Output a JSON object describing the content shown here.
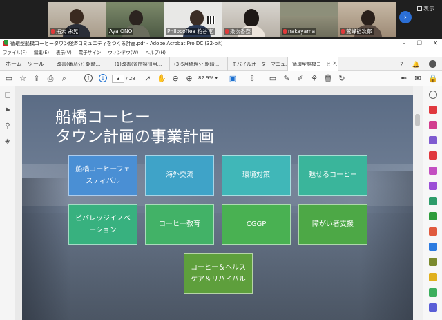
{
  "video_tiles": [
    {
      "name": "拓大 永晃",
      "muted": true
    },
    {
      "name": "Aya ONO",
      "muted": false
    },
    {
      "name": "Philocoffea 粕谷 哲",
      "muted": false
    },
    {
      "name": "染次香奈",
      "muted": true
    },
    {
      "name": "nakayama",
      "muted": true
    },
    {
      "name": "鷲峰裕次郎",
      "muted": true
    }
  ],
  "view_label": "表示",
  "window": {
    "title": "循環型船橋コーヒータウン経済コミュニティをつくる計画.pdf - Adobe Acrobat Pro DC (32-bit)",
    "menu": [
      "ファイル(F)",
      "編集(E)",
      "表示(V)",
      "電子サイン",
      "ウィンドウ(W)",
      "ヘルプ(H)"
    ]
  },
  "tabs": {
    "home": "ホーム",
    "tools": "ツール",
    "docs": [
      "改善(番茄分) 朝晴...",
      "(1)改善(省庁採出用...",
      "(3)5月修理分 朝晴...",
      "モバイルオーダーマニュ..."
    ],
    "active": "循環型船橋コーヒー..."
  },
  "toolbar": {
    "page_current": "3",
    "page_total": "/ 28",
    "zoom": "82.9%"
  },
  "slide": {
    "title_line1": "船橋コーヒー",
    "title_line2": "タウン計画の事業計画",
    "boxes": [
      {
        "label": "船橋コーヒーフェスティバル",
        "color": "#4a8fd4"
      },
      {
        "label": "海外交流",
        "color": "#3fa3c8"
      },
      {
        "label": "環境対策",
        "color": "#40b7b8"
      },
      {
        "label": "魅せるコーヒー",
        "color": "#3ab59b"
      },
      {
        "label": "ビバレッジイノベーション",
        "color": "#38b17f"
      },
      {
        "label": "コーヒー教育",
        "color": "#42b267"
      },
      {
        "label": "CGGP",
        "color": "#49b152"
      },
      {
        "label": "障がい者支援",
        "color": "#4da846"
      },
      {
        "label": "コーヒー＆ヘルスケア＆リバイバル",
        "color": "#5e9f3c"
      }
    ]
  }
}
